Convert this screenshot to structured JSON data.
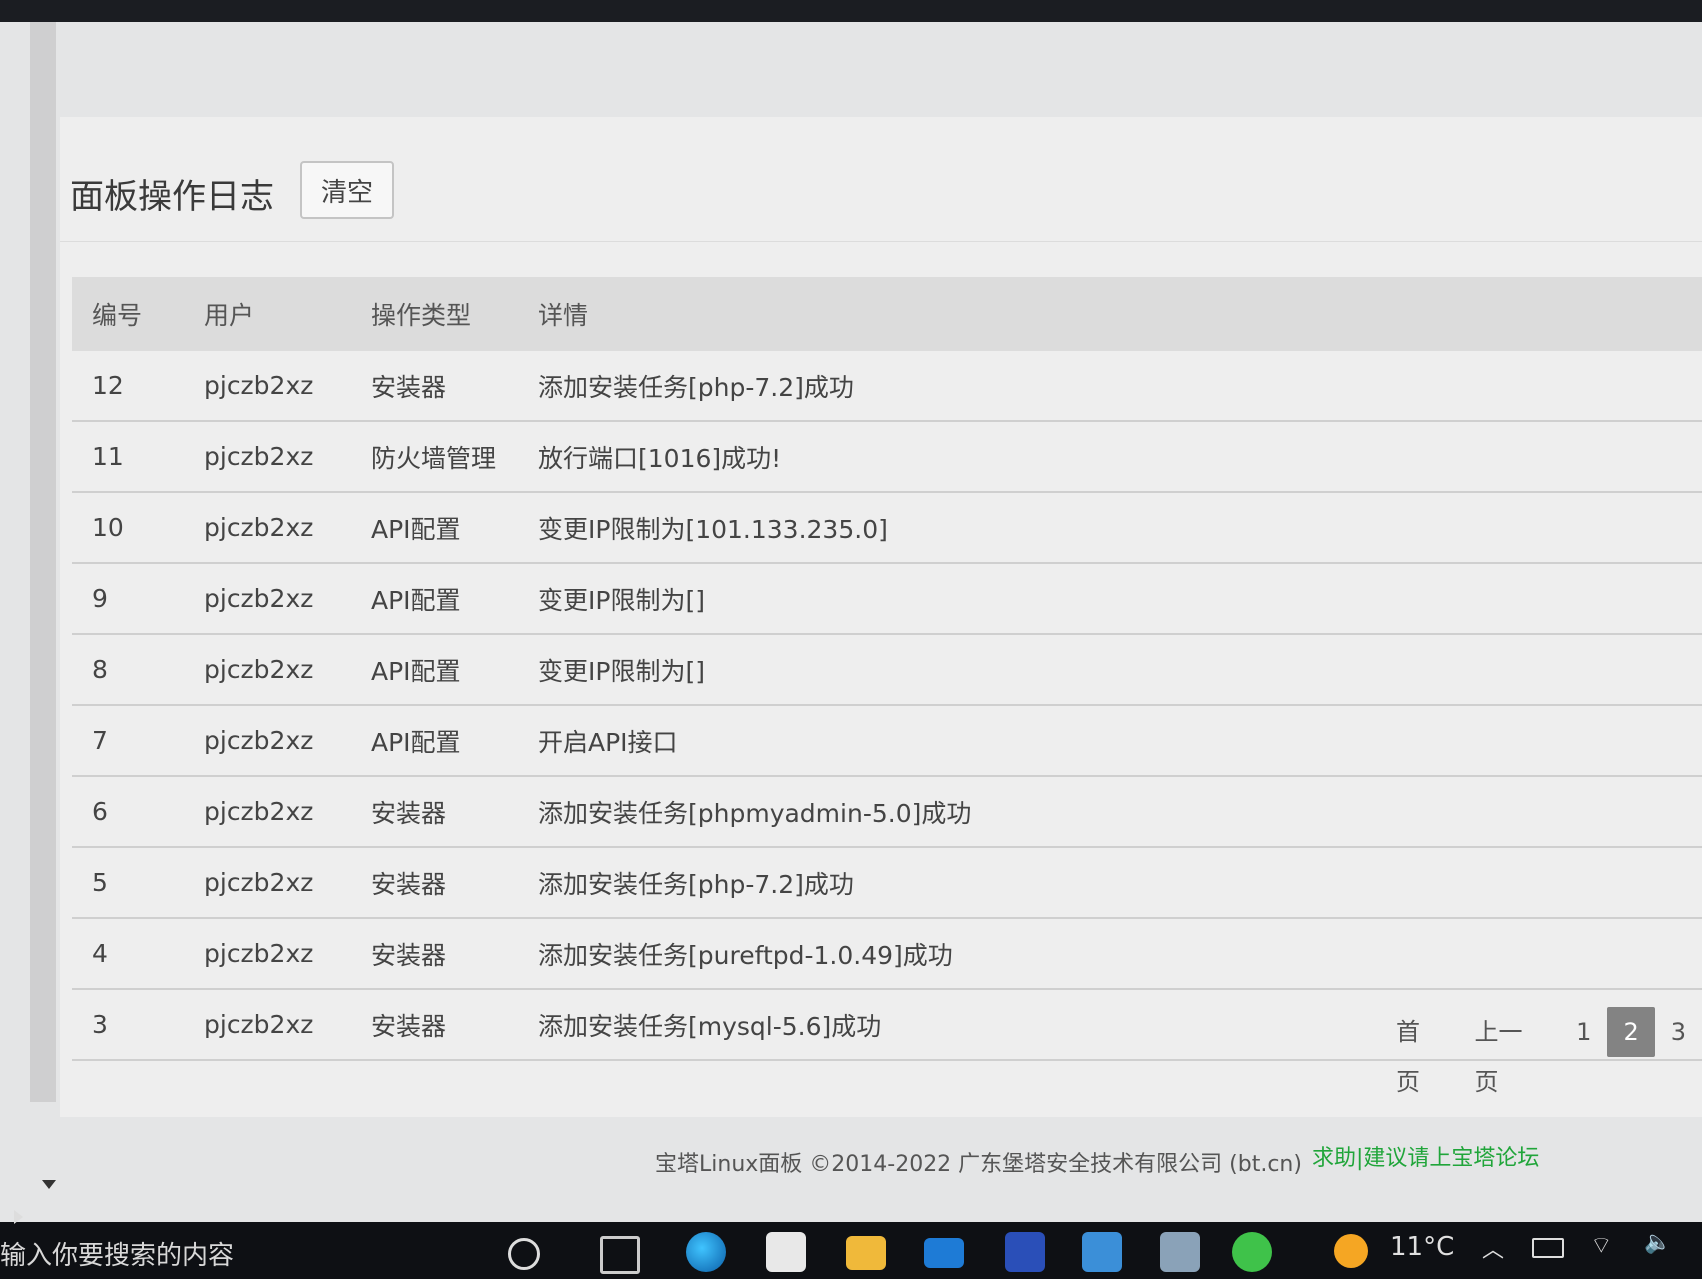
{
  "panel": {
    "title": "面板操作日志",
    "clear_label": "清空"
  },
  "table": {
    "headers": [
      "编号",
      "用户",
      "操作类型",
      "详情"
    ],
    "rows": [
      {
        "id": "12",
        "user": "pjczb2xz",
        "type": "安装器",
        "detail": "添加安装任务[php-7.2]成功"
      },
      {
        "id": "11",
        "user": "pjczb2xz",
        "type": "防火墙管理",
        "detail": "放行端口[1016]成功!"
      },
      {
        "id": "10",
        "user": "pjczb2xz",
        "type": "API配置",
        "detail": "变更IP限制为[101.133.235.0]"
      },
      {
        "id": "9",
        "user": "pjczb2xz",
        "type": "API配置",
        "detail": "变更IP限制为[]"
      },
      {
        "id": "8",
        "user": "pjczb2xz",
        "type": "API配置",
        "detail": "变更IP限制为[]"
      },
      {
        "id": "7",
        "user": "pjczb2xz",
        "type": "API配置",
        "detail": "开启API接口"
      },
      {
        "id": "6",
        "user": "pjczb2xz",
        "type": "安装器",
        "detail": "添加安装任务[phpmyadmin-5.0]成功"
      },
      {
        "id": "5",
        "user": "pjczb2xz",
        "type": "安装器",
        "detail": "添加安装任务[php-7.2]成功"
      },
      {
        "id": "4",
        "user": "pjczb2xz",
        "type": "安装器",
        "detail": "添加安装任务[pureftpd-1.0.49]成功"
      },
      {
        "id": "3",
        "user": "pjczb2xz",
        "type": "安装器",
        "detail": "添加安装任务[mysql-5.6]成功"
      }
    ]
  },
  "pagination": {
    "first": "首页",
    "prev": "上一页",
    "pages": [
      "1",
      "2",
      "3"
    ],
    "current": "2"
  },
  "footer": {
    "copyright": "宝塔Linux面板 ©2014-2022 广东堡塔安全技术有限公司 (bt.cn)",
    "forum_link": "求助|建议请上宝塔论坛"
  },
  "taskbar": {
    "search_placeholder": "输入你要搜索的内容",
    "temperature": "11°C",
    "icons": [
      "cortana-icon",
      "task-view-icon",
      "edge-icon",
      "store-icon",
      "file-explorer-icon",
      "mail-icon",
      "photos-icon",
      "app-icon",
      "app-icon",
      "wechat-icon"
    ]
  },
  "colors": {
    "forum_link": "#20a53a",
    "current_page_bg": "#838383",
    "table_header_bg": "#dcdcdc"
  }
}
